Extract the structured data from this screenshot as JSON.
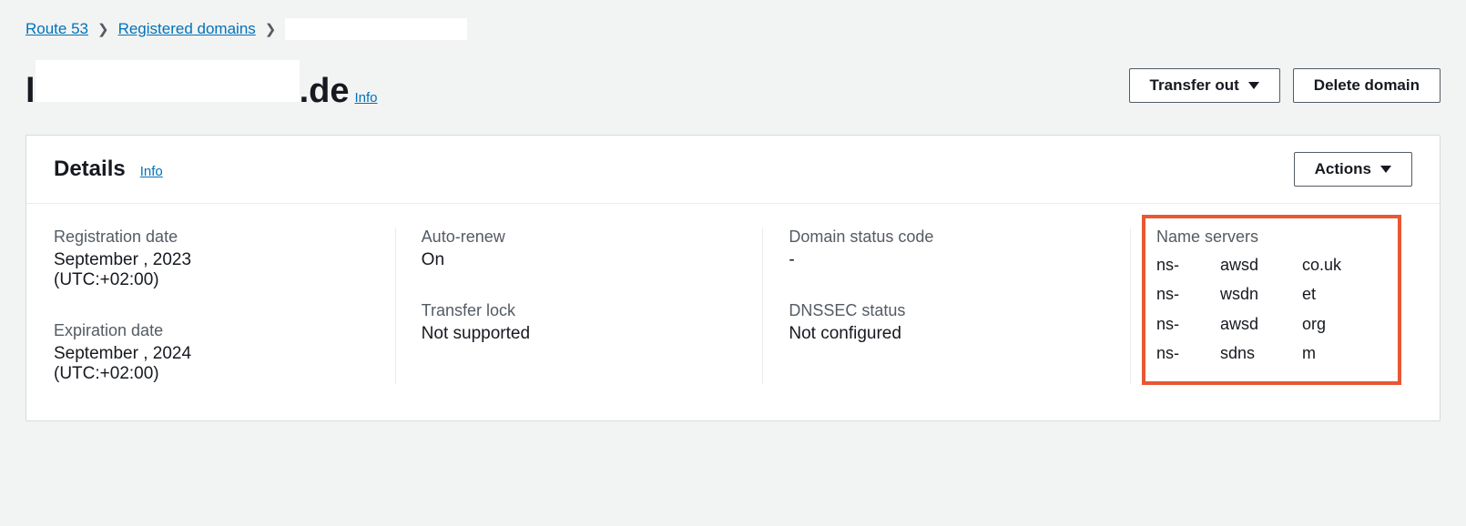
{
  "breadcrumb": {
    "root": "Route 53",
    "section": "Registered domains",
    "current": ""
  },
  "title": {
    "prefix": "l",
    "suffix": ".de",
    "info": "Info"
  },
  "topButtons": {
    "transfer": "Transfer out",
    "delete": "Delete domain"
  },
  "panel": {
    "title": "Details",
    "info": "Info",
    "actions": "Actions"
  },
  "fields": {
    "registrationLabel": "Registration date",
    "registrationValue": "September     , 2023",
    "registrationTz": "(UTC:+02:00)",
    "expirationLabel": "Expiration date",
    "expirationValue": "September     , 2024",
    "expirationTz": "(UTC:+02:00)",
    "autoRenewLabel": "Auto-renew",
    "autoRenewValue": "On",
    "transferLockLabel": "Transfer lock",
    "transferLockValue": "Not supported",
    "statusCodeLabel": "Domain status code",
    "statusCodeValue": "-",
    "dnssecLabel": "DNSSEC status",
    "dnssecValue": "Not configured",
    "nsLabel": "Name servers"
  },
  "nameServers": [
    {
      "p1": "ns-",
      "p2": "awsd",
      "p3": "co.uk"
    },
    {
      "p1": "ns-",
      "p2": "wsdn",
      "p3": "et"
    },
    {
      "p1": "ns-",
      "p2": "awsd",
      "p3": "org"
    },
    {
      "p1": "ns-",
      "p2": "sdns",
      "p3": "m"
    }
  ]
}
